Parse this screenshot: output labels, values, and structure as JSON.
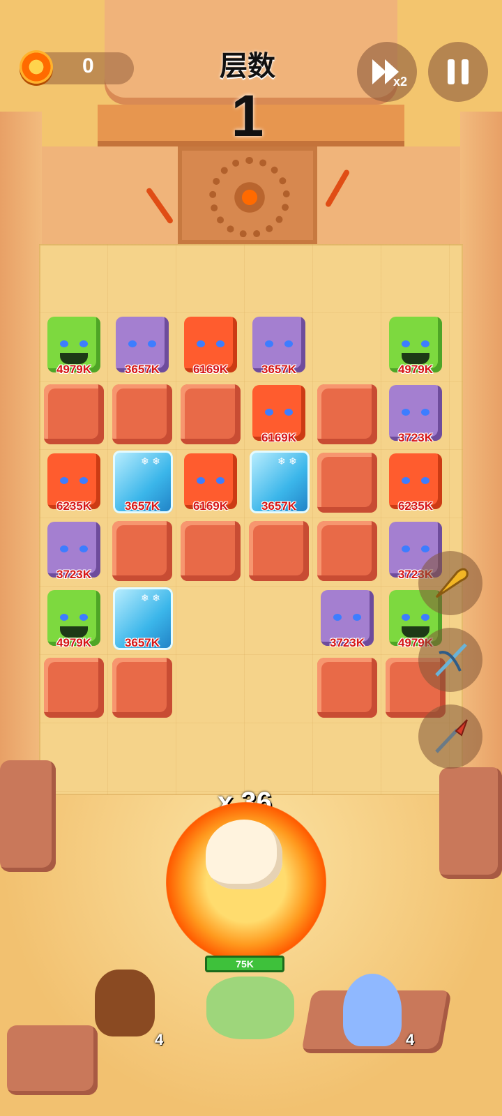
{
  "hud": {
    "coins": "0",
    "level_label": "层数",
    "level_number": "1",
    "speed_label": "x2"
  },
  "board": {
    "rows": [
      [
        {
          "type": "green",
          "hp": "4979K"
        },
        {
          "type": "purple",
          "hp": "3657K"
        },
        {
          "type": "red",
          "hp": "6169K"
        },
        {
          "type": "purple",
          "hp": "3657K"
        },
        {
          "type": "empty"
        },
        {
          "type": "green",
          "hp": "4979K"
        }
      ],
      [
        {
          "type": "block"
        },
        {
          "type": "block"
        },
        {
          "type": "block"
        },
        {
          "type": "red",
          "hp": "6169K"
        },
        {
          "type": "block"
        },
        {
          "type": "purple",
          "hp": "3723K"
        }
      ],
      [
        {
          "type": "red",
          "hp": "6235K"
        },
        {
          "type": "ice",
          "hp": "3657K"
        },
        {
          "type": "red",
          "hp": "6169K"
        },
        {
          "type": "ice",
          "hp": "3657K"
        },
        {
          "type": "block"
        },
        {
          "type": "red",
          "hp": "6235K"
        }
      ],
      [
        {
          "type": "purple",
          "hp": "3723K"
        },
        {
          "type": "block"
        },
        {
          "type": "block"
        },
        {
          "type": "block"
        },
        {
          "type": "block"
        },
        {
          "type": "purple",
          "hp": "3723K"
        }
      ],
      [
        {
          "type": "green",
          "hp": "4979K"
        },
        {
          "type": "ice",
          "hp": "3657K"
        },
        {
          "type": "empty"
        },
        {
          "type": "empty"
        },
        {
          "type": "purple",
          "hp": "3723K"
        },
        {
          "type": "green",
          "hp": "4979K"
        }
      ],
      [
        {
          "type": "block"
        },
        {
          "type": "block"
        },
        {
          "type": "empty"
        },
        {
          "type": "empty"
        },
        {
          "type": "block"
        },
        {
          "type": "block"
        }
      ]
    ]
  },
  "skills": [
    "horn-icon",
    "crossbow-icon",
    "spear-icon"
  ],
  "hero": {
    "multiplier": "x 36",
    "hp": "75K"
  },
  "pets": {
    "left_count": "4",
    "right_count": "4"
  }
}
